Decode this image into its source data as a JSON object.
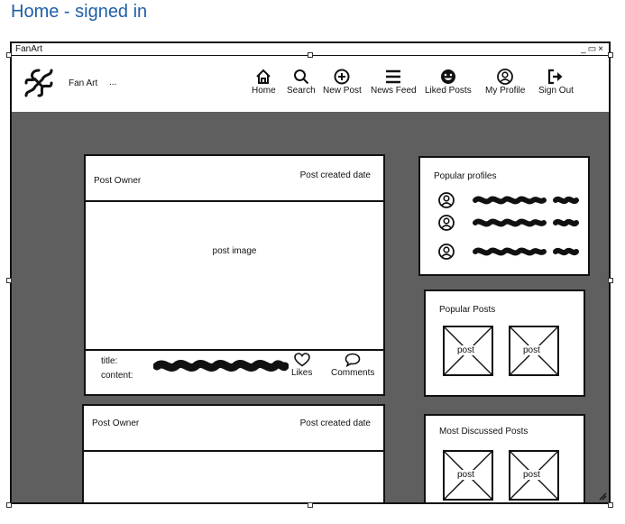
{
  "page": {
    "heading": "Home - signed in"
  },
  "window": {
    "title": "FanArt",
    "controls": "_▭×"
  },
  "navbar": {
    "brand": "Fan Art",
    "ellipsis": "...",
    "items": [
      {
        "label": "Home",
        "icon": "home-icon"
      },
      {
        "label": "Search",
        "icon": "search-icon"
      },
      {
        "label": "New Post",
        "icon": "plus-circle-icon"
      },
      {
        "label": "News Feed",
        "icon": "menu-icon"
      },
      {
        "label": "Liked Posts",
        "icon": "smiley-icon"
      },
      {
        "label": "My Profile",
        "icon": "user-circle-icon"
      },
      {
        "label": "Sign Out",
        "icon": "sign-out-icon"
      }
    ]
  },
  "posts": [
    {
      "owner": "Post Owner",
      "date": "Post created date",
      "image": "post image",
      "title_label": "title:",
      "content_label": "content:",
      "likes": "Likes",
      "comments": "Comments"
    },
    {
      "owner": "Post Owner",
      "date": "Post created date"
    }
  ],
  "popular_profiles": {
    "title": "Popular profiles"
  },
  "popular_posts": {
    "title": "Popular Posts",
    "thumbs": [
      "post",
      "post"
    ]
  },
  "most_discussed": {
    "title": "Most Discussed Posts",
    "thumbs": [
      "post",
      "post"
    ]
  }
}
